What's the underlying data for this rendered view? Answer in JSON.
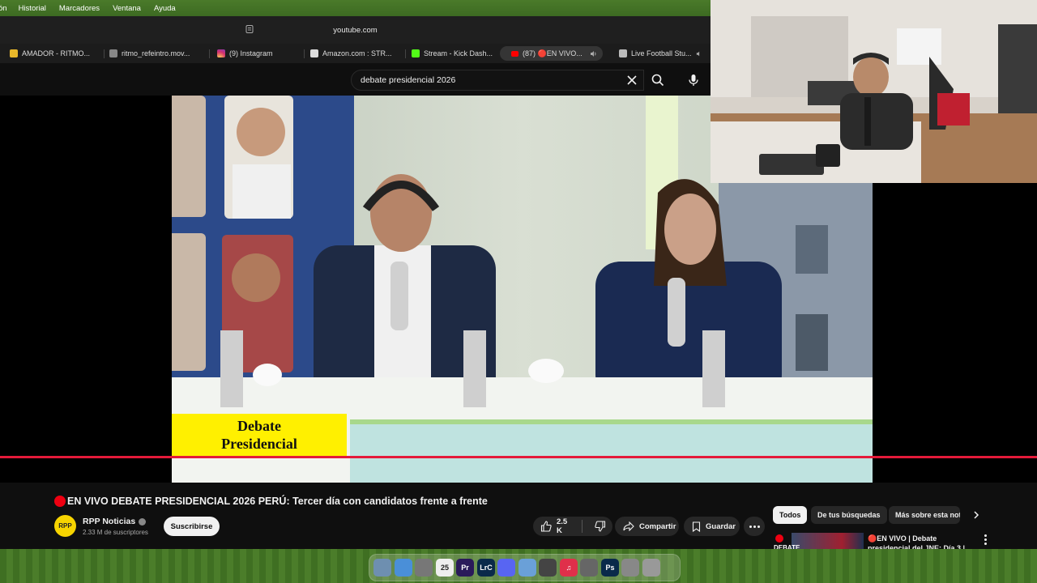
{
  "menubar": {
    "items": [
      "ón",
      "Historial",
      "Marcadores",
      "Ventana",
      "Ayuda"
    ]
  },
  "browser": {
    "url": "youtube.com",
    "tabs": [
      {
        "label": "AMADOR - RITMO...",
        "icon": "generic-favicon",
        "color": "#e8b82a"
      },
      {
        "label": "ritmo_refeintro.mov...",
        "icon": "generic-favicon",
        "color": "#888888"
      },
      {
        "label": "(9) Instagram",
        "icon": "instagram-icon",
        "color": "#d6306c"
      },
      {
        "label": "Amazon.com : STR...",
        "icon": "amazon-icon",
        "color": "#dddddd"
      },
      {
        "label": "Stream - Kick Dash...",
        "icon": "kick-icon",
        "color": "#53fc18"
      },
      {
        "label": "(87) 🔴EN VIVO...",
        "icon": "youtube-icon",
        "color": "#ff0000"
      },
      {
        "label": "Live Football Stu...",
        "icon": "generic-favicon",
        "color": "#bbbbbb"
      }
    ]
  },
  "youtube": {
    "search_query": "debate presidencial 2026",
    "video": {
      "lower_third": "Debate Presidencial",
      "progress_percent": 100,
      "title": "EN VIVO DEBATE PRESIDENCIAL 2026 PERÚ: Tercer día con candidatos frente a frente",
      "channel": "RPP Noticias",
      "channel_avatar_text": "RPP",
      "subscribers": "2.33 M de suscriptores",
      "subscribe_label": "Suscribirse",
      "likes": "2.5 K",
      "share_label": "Compartir",
      "save_label": "Guardar"
    },
    "chips": [
      "Todos",
      "De tus búsquedas",
      "Más sobre esta not"
    ],
    "recommendation": {
      "badge": "DEBATE",
      "title": "🔴EN VIVO | Debate presidencial del JNE: Día 3 |"
    }
  },
  "dock": {
    "apps": [
      {
        "icon": "finder-icon",
        "label": "",
        "color": "#6e8fb0"
      },
      {
        "icon": "safari-icon",
        "label": "",
        "color": "#4a8fd8"
      },
      {
        "icon": "storage-icon",
        "label": "",
        "color": "#777777"
      },
      {
        "icon": "calendar-icon",
        "label": "25",
        "color": "#eeeeee"
      },
      {
        "icon": "premiere-icon",
        "label": "Pr",
        "color": "#2a1a5a"
      },
      {
        "icon": "lightroom-icon",
        "label": "LrC",
        "color": "#0a2a4a"
      },
      {
        "icon": "discord-icon",
        "label": "",
        "color": "#5865f2"
      },
      {
        "icon": "finder-icon",
        "label": "",
        "color": "#6aa0d8"
      },
      {
        "icon": "controller-icon",
        "label": "",
        "color": "#444444"
      },
      {
        "icon": "music-icon",
        "label": "♫",
        "color": "#e0304a"
      },
      {
        "icon": "system-settings-icon",
        "label": "",
        "color": "#666666"
      },
      {
        "icon": "photoshop-icon",
        "label": "Ps",
        "color": "#0a2a4a"
      },
      {
        "icon": "app-icon",
        "label": "",
        "color": "#888888"
      },
      {
        "icon": "trash-icon",
        "label": "",
        "color": "#999999"
      }
    ]
  }
}
